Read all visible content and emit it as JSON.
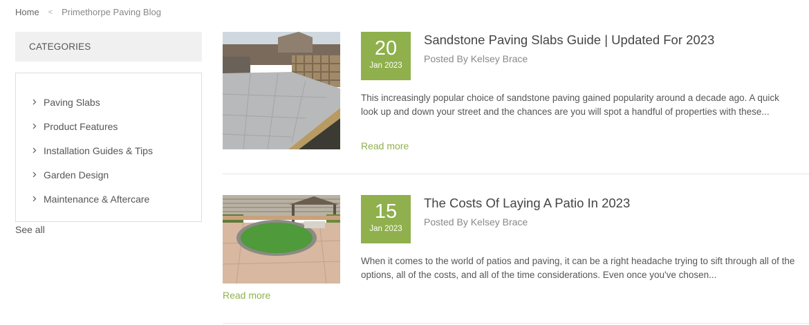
{
  "breadcrumb": {
    "home": "Home",
    "separator": "<",
    "current": "Primethorpe Paving Blog"
  },
  "sidebar": {
    "header": "CATEGORIES",
    "items": [
      {
        "label": "Paving Slabs"
      },
      {
        "label": "Product Features"
      },
      {
        "label": "Installation Guides & Tips"
      },
      {
        "label": "Garden Design"
      },
      {
        "label": "Maintenance & Aftercare"
      }
    ],
    "see_all": "See all"
  },
  "accent_color": "#8fb04c",
  "posts": [
    {
      "day": "20",
      "month": "Jan 2023",
      "title": "Sandstone Paving Slabs Guide | Updated For 2023",
      "author": "Posted By Kelsey Brace",
      "excerpt": "This increasingly popular choice of sandstone paving gained popularity around a decade ago. A quick look up and down your street and the chances are you will spot a handful of properties with these...",
      "read_more": "Read more"
    },
    {
      "day": "15",
      "month": "Jan 2023",
      "title": "The Costs Of Laying A Patio In 2023",
      "author": "Posted By Kelsey Brace",
      "excerpt": "When it comes to the world of patios and paving, it can be a right headache trying to sift through all of the options, all of the costs, and all of the time considerations. Even once you've chosen...",
      "read_more": "Read more"
    }
  ]
}
